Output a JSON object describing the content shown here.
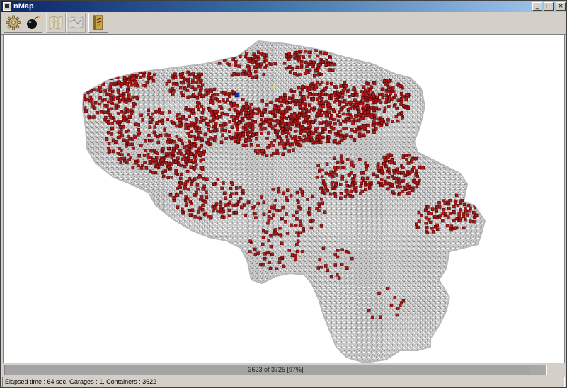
{
  "window": {
    "title": "nMap"
  },
  "window_buttons": {
    "minimize": "_",
    "maximize": "□",
    "close": "×"
  },
  "toolbar": {
    "buttons": [
      {
        "icon": "gear-icon",
        "enabled": true
      },
      {
        "icon": "bomb-icon",
        "enabled": true
      },
      {
        "icon": "map-icon",
        "enabled": false
      },
      {
        "icon": "network-map-icon",
        "enabled": false
      },
      {
        "icon": "book-icon",
        "enabled": true
      }
    ]
  },
  "colors": {
    "territory": "#a9a9a9",
    "container": "#b01818",
    "container_outline": "#3a0000",
    "garage": "#1030d0",
    "highlight": "#ffd800"
  },
  "progress": {
    "text": "3623 of 3725 [97%]",
    "fraction": 0.97
  },
  "status": {
    "text": "Elapsed time : 64 sec, Garages : 1, Containers : 3622"
  }
}
